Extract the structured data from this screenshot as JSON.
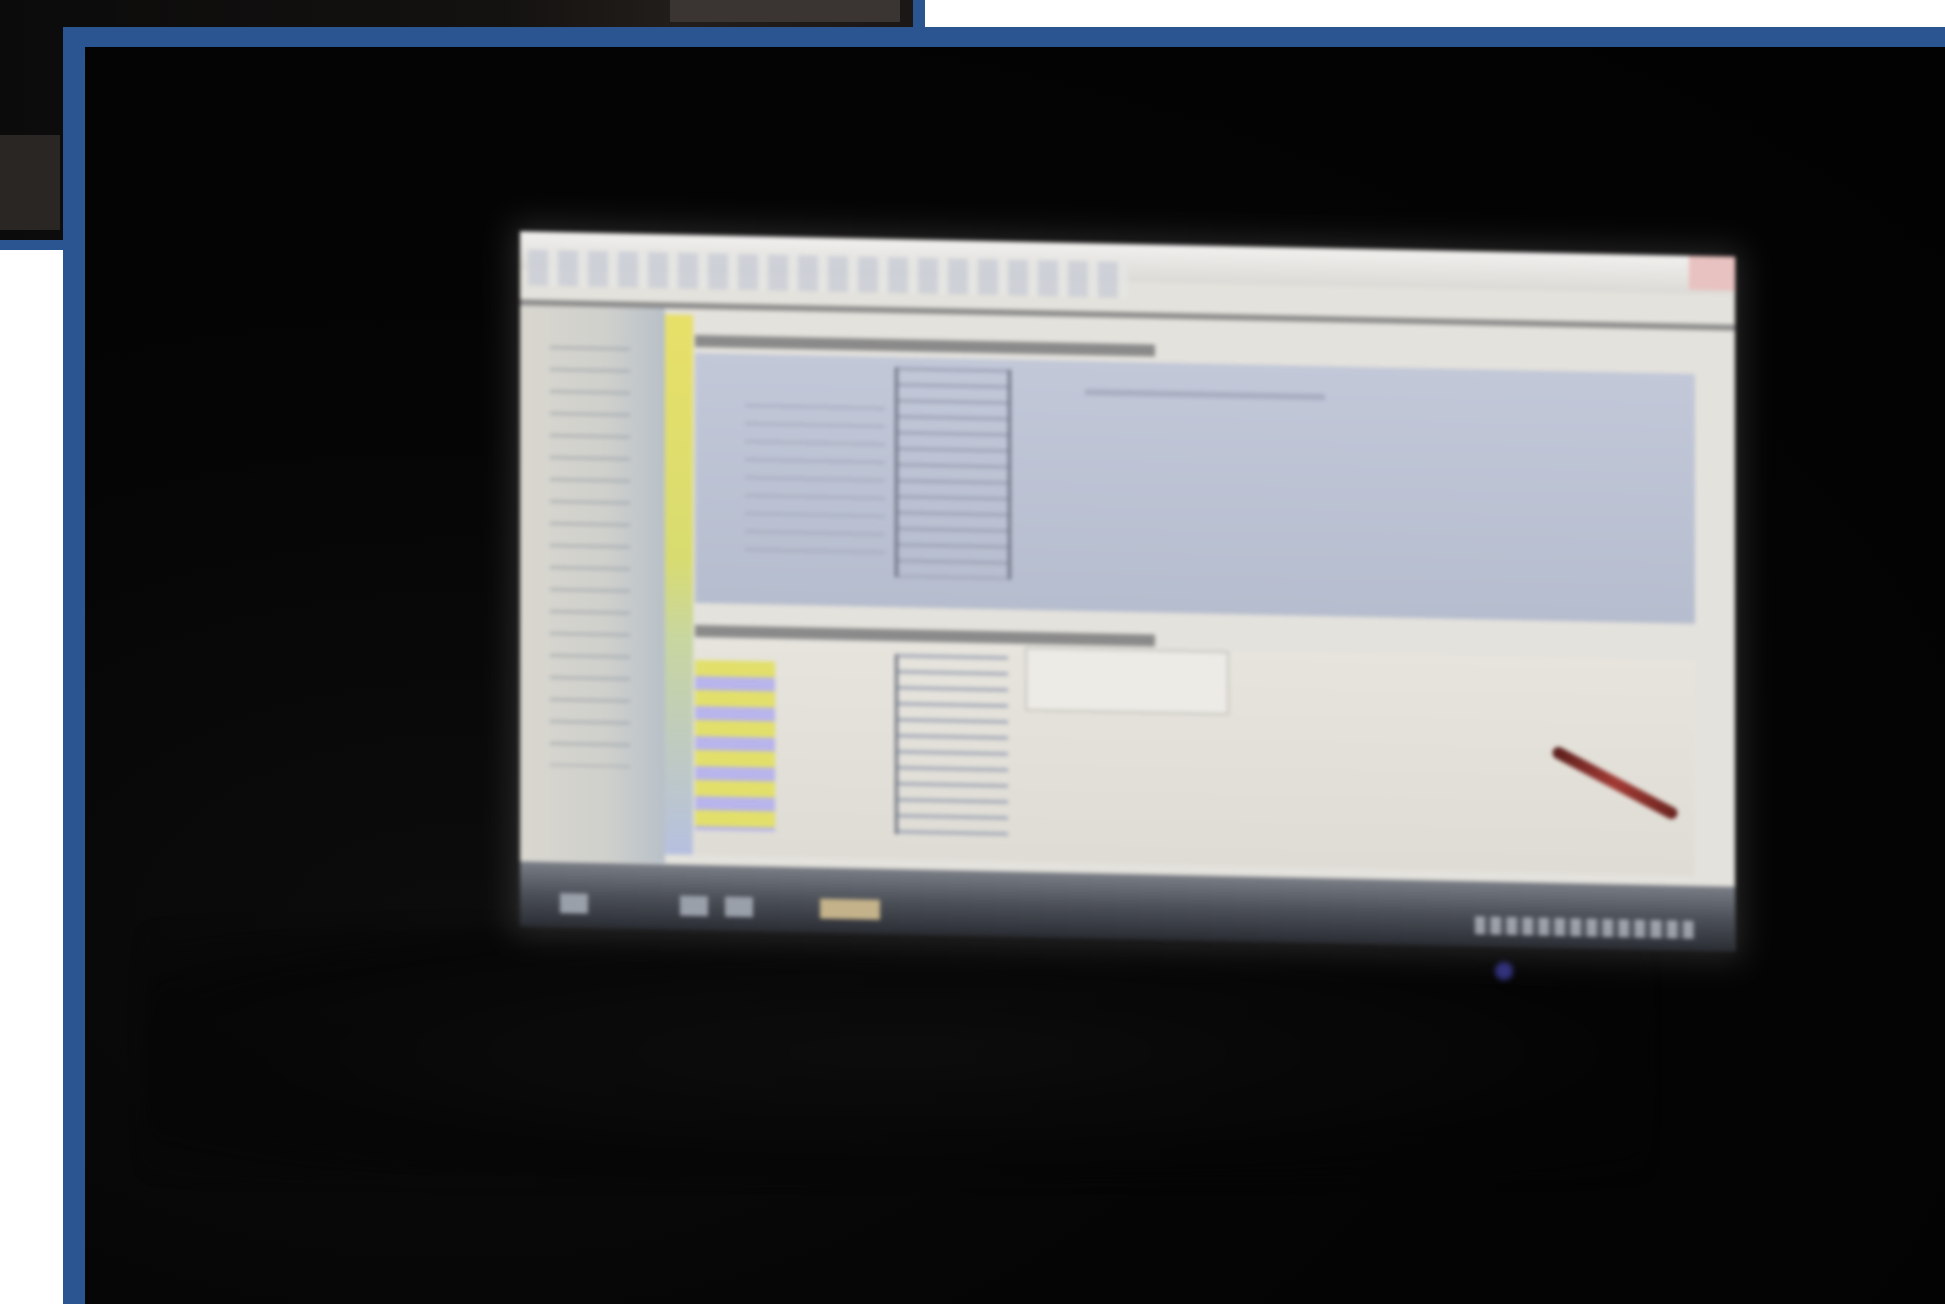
{
  "scene": {
    "kind": "photo-of-monitor",
    "frame_color": "#2a5590",
    "background_color": "#ffffff",
    "photo_background": "#030303",
    "screen_content": "spreadsheet-application"
  },
  "colors": {
    "accent_yellow": "#e2e06a",
    "accent_lavender": "#b8b4ec",
    "panel_blue": "#b6bdce",
    "cable_red": "#a23a34",
    "led_blue": "#3c3c9a"
  }
}
